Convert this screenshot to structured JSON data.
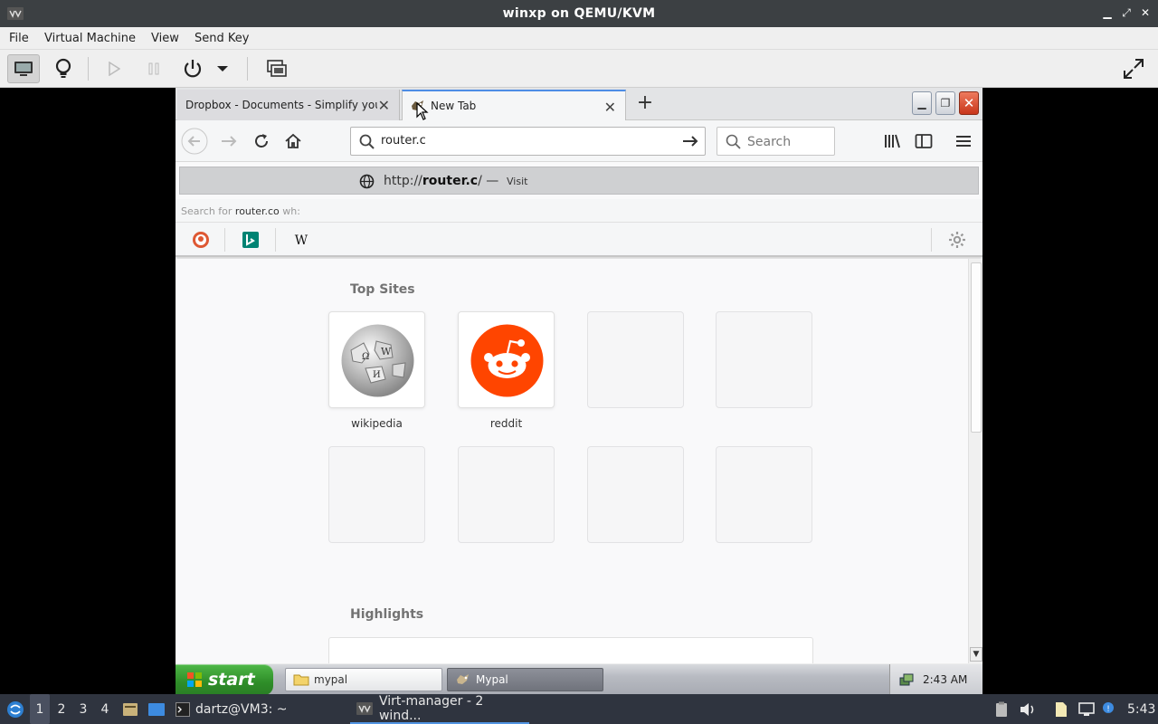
{
  "host_window": {
    "title": "winxp on QEMU/KVM",
    "menu": [
      "File",
      "Virtual Machine",
      "View",
      "Send Key"
    ]
  },
  "browser": {
    "tabs": [
      {
        "label": "Dropbox - Documents - Simplify your li"
      },
      {
        "label": "New Tab"
      }
    ],
    "url_input": "router.c",
    "search_placeholder": "Search",
    "dropdown": {
      "visit_url_prefix": "http://",
      "visit_url_bold": "router.c",
      "visit_url_suffix": "/",
      "visit_dash": " — ",
      "visit_label": "Visit",
      "search_for_prefix": "Search for ",
      "search_for_query": "router.co",
      "search_for_suffix": " wh:",
      "engines": [
        "duckduckgo-icon",
        "bing-icon",
        "wikipedia-icon"
      ]
    },
    "content": {
      "top_sites_title": "Top Sites",
      "top_sites": [
        {
          "label": "wikipedia"
        },
        {
          "label": "reddit"
        }
      ],
      "highlights_title": "Highlights"
    }
  },
  "xp_taskbar": {
    "start_label": "start",
    "tasks": [
      {
        "label": "mypal"
      },
      {
        "label": "Mypal"
      }
    ],
    "clock": "2:43 AM"
  },
  "host_taskbar": {
    "workspaces": [
      "1",
      "2",
      "3",
      "4"
    ],
    "terminal_label": "dartz@VM3: ~",
    "virt_manager_label": "Virt-manager - 2 wind...",
    "clock": "5:43"
  },
  "colors": {
    "reddit_orange": "#ff4500",
    "xp_start_green": "#3a9d33",
    "accent_blue": "#4d8de5"
  }
}
